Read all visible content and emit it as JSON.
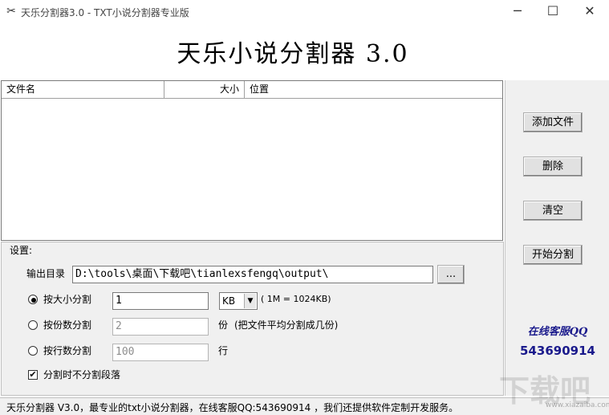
{
  "window": {
    "title": "天乐分割器3.0 - TXT小说分割器专业版",
    "app_icon": "scissors-icon",
    "controls": {
      "minimize": "─",
      "maximize": "☐",
      "close": "✕"
    }
  },
  "banner": {
    "title": "天乐小说分割器 3.0"
  },
  "file_list": {
    "columns": [
      "文件名",
      "大小",
      "位置"
    ],
    "rows": []
  },
  "right_panel": {
    "add_button": "添加文件",
    "delete_button": "删除",
    "clear_button": "清空",
    "start_button": "开始分割",
    "service_title": "在线客服QQ",
    "service_number": "543690914"
  },
  "settings": {
    "legend": "设置:",
    "output_dir_label": "输出目录",
    "output_dir_value": "D:\\tools\\桌面\\下载吧\\tianlexsfengq\\output\\",
    "browse_button": "...",
    "by_size": {
      "label": "按大小分割",
      "value": "1",
      "unit": "KB",
      "note": "( 1M = 1024KB)",
      "selected": true
    },
    "by_parts": {
      "label": "按份数分割",
      "value": "2",
      "unit": "份",
      "note": "(把文件平均分割成几份)",
      "selected": false
    },
    "by_lines": {
      "label": "按行数分割",
      "value": "100",
      "unit": "行",
      "selected": false
    },
    "no_split_paragraph": {
      "label": "分割时不分割段落",
      "checked": true
    }
  },
  "status_bar": {
    "text": "天乐分割器 V3.0，最专业的txt小说分割器，在线客服QQ:543690914 ，我们还提供软件定制开发服务。"
  },
  "watermark": {
    "text": "下载吧",
    "url": "www.xiazaiba.com"
  }
}
